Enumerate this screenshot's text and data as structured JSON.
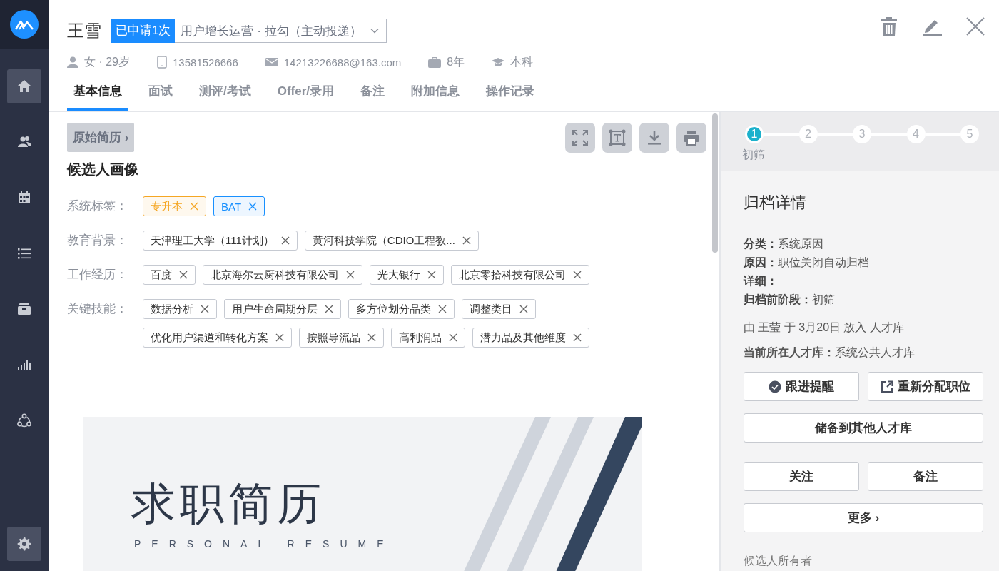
{
  "sidebar": {
    "items": [
      {
        "kind": "home",
        "selected": true
      },
      {
        "kind": "people",
        "selected": false
      },
      {
        "kind": "calendar",
        "selected": false
      },
      {
        "kind": "list",
        "selected": false
      },
      {
        "kind": "archive",
        "selected": false
      },
      {
        "kind": "chart",
        "selected": false
      },
      {
        "kind": "network",
        "selected": false
      }
    ],
    "settings": {
      "selected": true
    }
  },
  "header": {
    "name": "王雪",
    "apply_badge": "已申请1次",
    "position": "用户增长运营 · 拉勾（主动投递）",
    "info": [
      {
        "kind": "person",
        "text": "女 · 29岁"
      },
      {
        "kind": "phone",
        "text": "13581526666"
      },
      {
        "kind": "mail",
        "text": "14213226688@163.com"
      },
      {
        "kind": "briefcase",
        "text": "8年"
      },
      {
        "kind": "degree",
        "text": "本科"
      }
    ]
  },
  "tabs": [
    {
      "label": "基本信息",
      "selected": true
    },
    {
      "label": "面试",
      "selected": false
    },
    {
      "label": "测评/考试",
      "selected": false
    },
    {
      "label": "Offer/录用",
      "selected": false
    },
    {
      "label": "备注",
      "selected": false
    },
    {
      "label": "附加信息",
      "selected": false
    },
    {
      "label": "操作记录",
      "selected": false
    }
  ],
  "resume_button": "原始简历 ›",
  "portrait": {
    "title": "候选人画像",
    "rows": [
      {
        "label": "系统标签：",
        "tags": [
          {
            "text": "专升本",
            "color": "#f5a623"
          },
          {
            "text": "BAT",
            "color": "#1890ff"
          }
        ]
      },
      {
        "label": "教育背景：",
        "tags": [
          {
            "text": "天津理工大学（111计划）"
          },
          {
            "text": "黄河科技学院（CDIO工程教..."
          }
        ]
      },
      {
        "label": "工作经历：",
        "tags": [
          {
            "text": "百度"
          },
          {
            "text": "北京海尔云厨科技有限公司"
          },
          {
            "text": "光大银行"
          },
          {
            "text": "北京零拾科技有限公司"
          }
        ]
      },
      {
        "label": "关键技能：",
        "tags": [
          {
            "text": "数据分析"
          },
          {
            "text": "用户生命周期分层"
          },
          {
            "text": "多方位划分品类"
          },
          {
            "text": "调整类目"
          },
          {
            "text": "优化用户渠道和转化方案"
          },
          {
            "text": "按照导流品"
          },
          {
            "text": "高利润品"
          },
          {
            "text": "潜力品及其他维度"
          }
        ]
      }
    ]
  },
  "resume_preview": {
    "title": "求职简历",
    "subtitle": "PERSONAL RESUME"
  },
  "steps": [
    {
      "number": "1",
      "label": "初筛",
      "selected": true
    },
    {
      "number": "2",
      "selected": false
    },
    {
      "number": "3",
      "selected": false
    },
    {
      "number": "4",
      "selected": false
    },
    {
      "number": "5",
      "selected": false
    }
  ],
  "archive": {
    "title": "归档详情",
    "details": [
      "**分类：**系统原因",
      "**原因：**职位关闭自动归档",
      "**详细：**",
      "**归档前阶段：**初筛"
    ],
    "placed": "由 王莹 于 3月20日 放入 人才库",
    "current_pool": "**当前所在人才库：**系统公共人才库",
    "button_rows": [
      [
        {
          "label": "跟进提醒",
          "kind": "check"
        },
        {
          "label": "重新分配职位",
          "kind": "external"
        }
      ],
      [
        {
          "label": "储备到其他人才库",
          "kind": "plain"
        }
      ],
      [
        {
          "label": "关注",
          "kind": "plain"
        },
        {
          "label": "备注",
          "kind": "plain"
        }
      ],
      [
        {
          "label": "更多 ›",
          "kind": "plain"
        }
      ]
    ],
    "owner_label": "候选人所有者"
  }
}
